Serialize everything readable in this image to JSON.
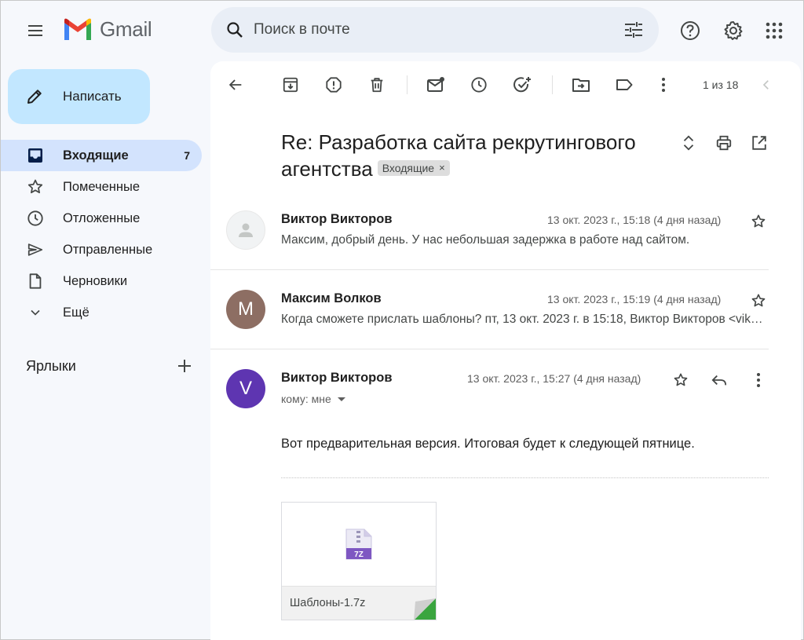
{
  "app": {
    "name": "Gmail"
  },
  "search": {
    "placeholder": "Поиск в почте"
  },
  "sidebar": {
    "compose_label": "Написать",
    "items": [
      {
        "label": "Входящие",
        "count": "7",
        "active": true,
        "icon": "inbox-icon"
      },
      {
        "label": "Помеченные",
        "count": "",
        "active": false,
        "icon": "star-icon"
      },
      {
        "label": "Отложенные",
        "count": "",
        "active": false,
        "icon": "clock-icon"
      },
      {
        "label": "Отправленные",
        "count": "",
        "active": false,
        "icon": "send-icon"
      },
      {
        "label": "Черновики",
        "count": "",
        "active": false,
        "icon": "draft-icon"
      },
      {
        "label": "Ещё",
        "count": "",
        "active": false,
        "icon": "chevron-down-icon"
      }
    ],
    "labels_title": "Ярлыки"
  },
  "toolbar": {
    "pager": "1 из 18"
  },
  "thread": {
    "subject": "Re: Разработка сайта рекрутингового агентства",
    "chip_label": "Входящие",
    "chip_close": "×"
  },
  "messages": [
    {
      "sender": "Виктор Викторов",
      "date": "13 окт. 2023 г., 15:18 (4 дня назад)",
      "snippet": " Максим, добрый день. У нас небольшая задержка в работе над сайтом.",
      "avatar": "",
      "avatar_color": "#f1f3f4"
    },
    {
      "sender": "Максим Волков",
      "date": "13 окт. 2023 г., 15:19 (4 дня назад)",
      "snippet": "Когда сможете прислать шаблоны? пт, 13 окт. 2023 г. в 15:18, Виктор Викторов <viktor_viktorov@gmail.com>:",
      "avatar": "M",
      "avatar_color": "#8d6e63"
    },
    {
      "sender": "Виктор Викторов",
      "date": "13 окт. 2023 г., 15:27 (4 дня назад)",
      "to": "кому: мне",
      "body": "Вот предварительная версия. Итоговая будет к следующей пятнице.",
      "avatar": "V",
      "avatar_color": "#5e35b1",
      "attachment": {
        "name": "Шаблоны-1.7z",
        "badge": "7Z"
      }
    }
  ],
  "colors": {
    "accent": "#c2e7ff",
    "active_nav": "#d3e3fd",
    "background": "#f6f8fc",
    "attachment_fold": "#3aa53f"
  }
}
